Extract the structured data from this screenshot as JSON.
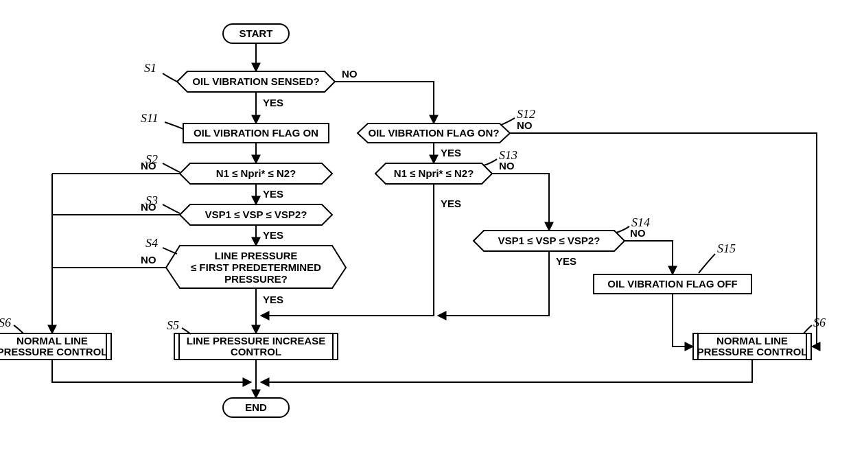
{
  "nodes": {
    "start": "START",
    "end": "END",
    "s1": "OIL VIBRATION SENSED?",
    "s11": "OIL VIBRATION FLAG ON",
    "s12": "OIL VIBRATION FLAG ON?",
    "s2": "N1 ≤ Npri* ≤ N2?",
    "s13": "N1 ≤ Npri* ≤ N2?",
    "s3": "VSP1 ≤ VSP ≤ VSP2?",
    "s14": "VSP1 ≤ VSP ≤ VSP2?",
    "s4_l1": "LINE PRESSURE",
    "s4_l2": "≤ FIRST PREDETERMINED",
    "s4_l3": "PRESSURE?",
    "s15": "OIL VIBRATION FLAG OFF",
    "s5_l1": "LINE PRESSURE INCREASE",
    "s5_l2": "CONTROL",
    "s6_l1": "NORMAL LINE",
    "s6_l2": "PRESSURE CONTROL"
  },
  "labels": {
    "s1": "S1",
    "s2": "S2",
    "s3": "S3",
    "s4": "S4",
    "s5": "S5",
    "s6": "S6",
    "s11": "S11",
    "s12": "S12",
    "s13": "S13",
    "s14": "S14",
    "s15": "S15"
  },
  "edges": {
    "yes": "YES",
    "no": "NO"
  }
}
